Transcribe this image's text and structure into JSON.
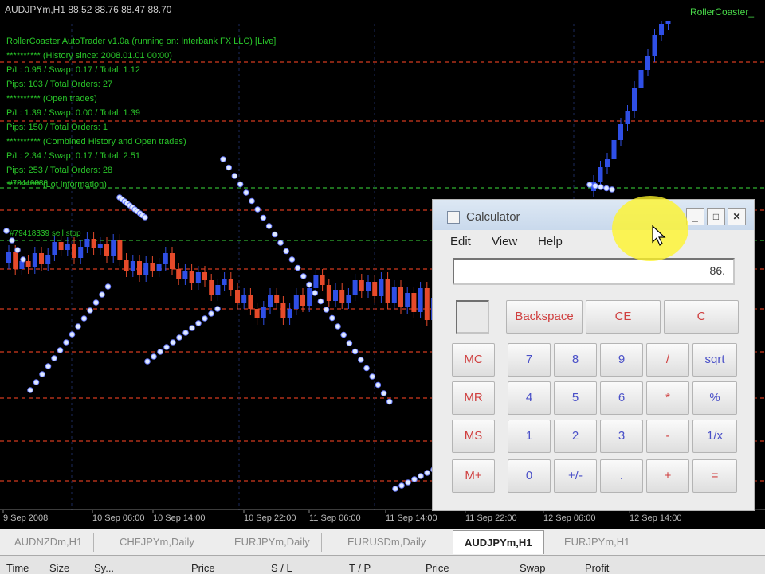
{
  "chart_window": {
    "title": "AUDJPYm,H1  88.52 88.76 88.47 88.70",
    "ea_name": "RollerCoaster_"
  },
  "info_lines": [
    "RollerCoaster AutoTrader v1.0a (running on: Interbank FX LLC) [Live]",
    "**********  (History since: 2008.01.01 00:00)",
    "P/L: 0.95 / Swap: 0.17 / Total: 1.12",
    "Pips: 103 / Total Orders: 27",
    "**********  (Open trades)",
    "P/L: 1.39 / Swap: 0.00 / Total: 1.39",
    "Pips: 150 / Total Orders: 1",
    "**********  (Combined History and Open trades)",
    "P/L: 2.34 / Swap: 0.17 / Total: 2.51",
    "Pips: 253 / Total Orders: 28",
    "**********  (Lot information)"
  ],
  "chart_labels": {
    "order_1": "#78440888",
    "order_2": "#79418339 sell stop"
  },
  "time_axis": [
    "9 Sep 2008",
    "10 Sep 06:00",
    "10 Sep 14:00",
    "10 Sep 22:00",
    "11 Sep 06:00",
    "11 Sep 14:00",
    "11 Sep 22:00",
    "12 Sep 06:00",
    "12 Sep 14:00"
  ],
  "tabs": [
    {
      "label": "AUDNZDm,H1",
      "active": false
    },
    {
      "label": "CHFJPYm,Daily",
      "active": false
    },
    {
      "label": "EURJPYm,Daily",
      "active": false
    },
    {
      "label": "EURUSDm,Daily",
      "active": false
    },
    {
      "label": "AUDJPYm,H1",
      "active": true
    },
    {
      "label": "EURJPYm,H1",
      "active": false
    }
  ],
  "columns": [
    "Time",
    "Size",
    "Sy...",
    "Price",
    "S / L",
    "T / P",
    "Price",
    "Swap",
    "Profit"
  ],
  "calculator": {
    "title": "Calculator",
    "menu": [
      "Edit",
      "View",
      "Help"
    ],
    "display": "86.",
    "row_top": [
      "Backspace",
      "CE",
      "C"
    ],
    "memory": [
      "MC",
      "MR",
      "MS",
      "M+"
    ],
    "keys": [
      [
        "7",
        "8",
        "9",
        "/",
        "sqrt"
      ],
      [
        "4",
        "5",
        "6",
        "*",
        "%"
      ],
      [
        "1",
        "2",
        "3",
        "-",
        "1/x"
      ],
      [
        "0",
        "+/-",
        ".",
        "+",
        "="
      ]
    ]
  },
  "colors": {
    "bull_candle": "#2f4fe6",
    "bear_candle": "#e64a2a",
    "level_line_red": "#d03a1f",
    "level_line_green": "#2fae2f",
    "sar_dot": "#dfe9ff"
  }
}
